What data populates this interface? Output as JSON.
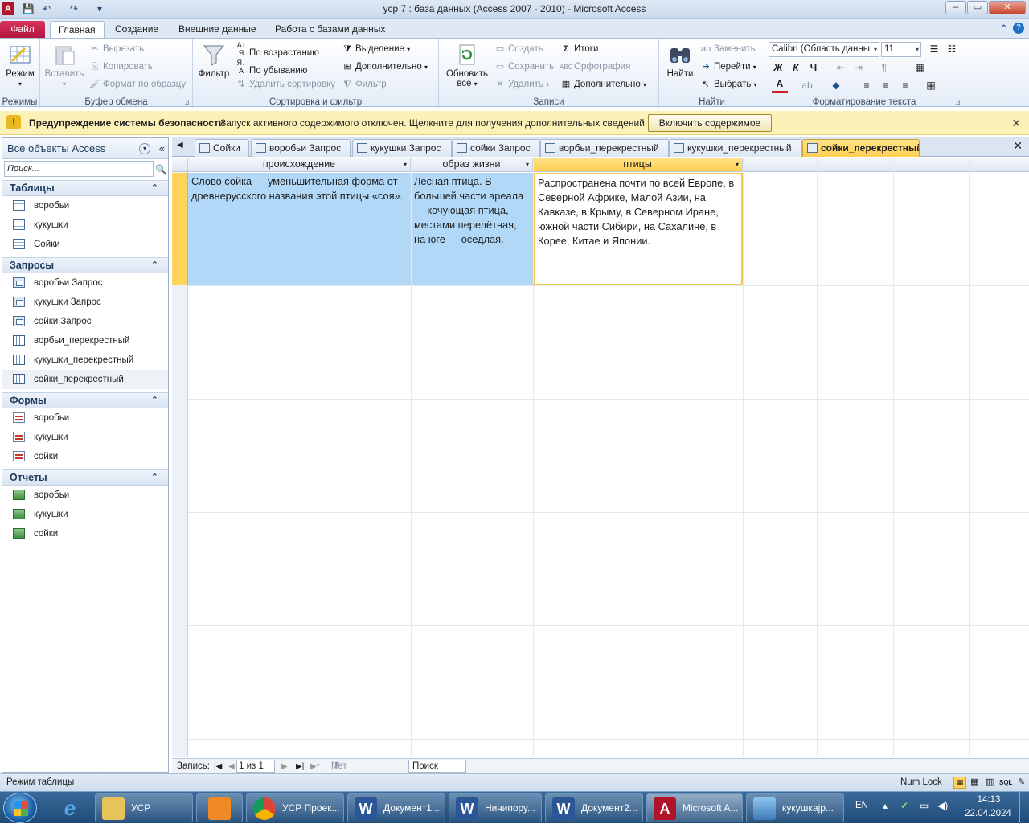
{
  "window": {
    "title": "уср 7 : база данных (Access 2007 - 2010)  -  Microsoft Access",
    "app_icon_letter": "A",
    "controls": [
      "–",
      "▭",
      "✕"
    ]
  },
  "ribbon_tabs": [
    "Файл",
    "Главная",
    "Создание",
    "Внешние данные",
    "Работа с базами данных"
  ],
  "ribbon": {
    "groups": {
      "modes": "Режимы",
      "clipboard": "Буфер обмена",
      "sort_filter": "Сортировка и фильтр",
      "records": "Записи",
      "find": "Найти",
      "text_format": "Форматирование текста"
    },
    "mode_btn": "Режим",
    "paste_btn": "Вставить",
    "cut": "Вырезать",
    "copy": "Копировать",
    "format_painter": "Формат по образцу",
    "filter_btn": "Фильтр",
    "sort_asc": "По возрастанию",
    "sort_desc": "По убыванию",
    "remove_sort": "Удалить сортировку",
    "selection": "Выделение",
    "advanced": "Дополнительно",
    "toggle_filter": "Фильтр",
    "refresh_btn_1": "Обновить",
    "refresh_btn_2": "все",
    "new": "Создать",
    "save": "Сохранить",
    "delete": "Удалить",
    "totals": "Итоги",
    "spelling": "Орфография",
    "more": "Дополнительно",
    "find_btn": "Найти",
    "replace": "Заменить",
    "goto": "Перейти",
    "select": "Выбрать",
    "font_name": "Calibri (Область данны:",
    "font_size": "11",
    "bold": "Ж",
    "italic": "К",
    "underline": "Ч"
  },
  "security": {
    "title": "Предупреждение системы безопасности",
    "message": "Запуск активного содержимого отключен. Щелкните для получения дополнительных сведений.",
    "button": "Включить содержимое"
  },
  "nav": {
    "header": "Все объекты Access",
    "search_placeholder": "Поиск...",
    "sections": [
      {
        "title": "Таблицы",
        "items": [
          {
            "label": "воробьи",
            "type": "tbl"
          },
          {
            "label": "кукушки",
            "type": "tbl"
          },
          {
            "label": "Сойки",
            "type": "tbl"
          }
        ]
      },
      {
        "title": "Запросы",
        "items": [
          {
            "label": "воробьи Запрос",
            "type": "qry"
          },
          {
            "label": "кукушки Запрос",
            "type": "qry"
          },
          {
            "label": "сойки Запрос",
            "type": "qry"
          },
          {
            "label": "ворбьи_перекрестный",
            "type": "xt"
          },
          {
            "label": "кукушки_перекрестный",
            "type": "xt"
          },
          {
            "label": "сойки_перекрестный",
            "type": "xt",
            "selected": true
          }
        ]
      },
      {
        "title": "Формы",
        "items": [
          {
            "label": "воробьи",
            "type": "frm"
          },
          {
            "label": "кукушки",
            "type": "frm"
          },
          {
            "label": "сойки",
            "type": "frm"
          }
        ]
      },
      {
        "title": "Отчеты",
        "items": [
          {
            "label": "воробьи",
            "type": "rpt"
          },
          {
            "label": "кукушки",
            "type": "rpt"
          },
          {
            "label": "сойки",
            "type": "rpt"
          }
        ]
      }
    ]
  },
  "doc_tabs": [
    {
      "label": "Сойки"
    },
    {
      "label": "воробьи Запрос"
    },
    {
      "label": "кукушки Запрос"
    },
    {
      "label": "сойки Запрос"
    },
    {
      "label": "ворбьи_перекрестный"
    },
    {
      "label": "кукушки_перекрестный"
    },
    {
      "label": "сойки_перекрестный",
      "active": true
    }
  ],
  "grid": {
    "columns": [
      "происхождение",
      "образ жизни",
      "птицы"
    ],
    "row": [
      "Слово сойка — уменьшительная форма от древнерусского названия этой птицы «соя».",
      "Лесная птица. В большей части ареала — кочующая птица, местами перелётная, на юге — оседлая.",
      "Распространена почти по всей Европе, в Северной Африке, Малой Азии, на Кавказе, в Крыму, в Северном Иране, южной части Сибири, на Сахалине, в Корее, Китае и Японии."
    ]
  },
  "record_nav": {
    "label": "Запись:",
    "position": "1 из 1",
    "filter": "Нет фильтра",
    "search": "Поиск"
  },
  "status": {
    "mode": "Режим таблицы",
    "numlock": "Num Lock"
  },
  "taskbar": {
    "items": [
      "УСР",
      "",
      "УСР Проек...",
      "Документ1...",
      "Ничипору...",
      "Документ2...",
      "Microsoft A...",
      "кукушкаjp..."
    ],
    "lang": "EN",
    "time": "14:13",
    "date": "22.04.2024"
  }
}
